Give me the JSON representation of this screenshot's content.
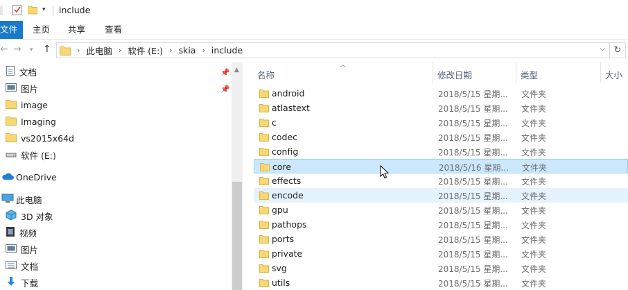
{
  "window": {
    "title": "include"
  },
  "ribbon": {
    "tabs": [
      "文件",
      "主页",
      "共享",
      "查看"
    ]
  },
  "address": {
    "crumbs": [
      "此电脑",
      "软件 (E:)",
      "skia",
      "include"
    ]
  },
  "nav": {
    "items": [
      {
        "label": "文档",
        "icon": "documents-icon",
        "pinned": true
      },
      {
        "label": "图片",
        "icon": "pictures-icon",
        "pinned": true
      },
      {
        "label": "image",
        "icon": "folder-icon"
      },
      {
        "label": "Imaging",
        "icon": "folder-icon"
      },
      {
        "label": "vs2015x64d",
        "icon": "folder-icon"
      },
      {
        "label": "软件 (E:)",
        "icon": "drive-icon"
      },
      {
        "label": "OneDrive",
        "icon": "onedrive-icon"
      },
      {
        "label": "此电脑",
        "icon": "this-pc-icon"
      },
      {
        "label": "3D 对象",
        "icon": "3d-objects-icon"
      },
      {
        "label": "视频",
        "icon": "videos-icon"
      },
      {
        "label": "图片",
        "icon": "pictures-icon"
      },
      {
        "label": "文档",
        "icon": "documents-icon"
      },
      {
        "label": "下载",
        "icon": "downloads-icon"
      }
    ]
  },
  "columns": {
    "name": "名称",
    "modified": "修改日期",
    "type": "类型",
    "size": "大小"
  },
  "files": [
    {
      "name": "android",
      "date": "2018/5/15 星期...",
      "type": "文件夹"
    },
    {
      "name": "atlastext",
      "date": "2018/5/15 星期...",
      "type": "文件夹"
    },
    {
      "name": "c",
      "date": "2018/5/15 星期...",
      "type": "文件夹"
    },
    {
      "name": "codec",
      "date": "2018/5/15 星期...",
      "type": "文件夹"
    },
    {
      "name": "config",
      "date": "2018/5/15 星期...",
      "type": "文件夹"
    },
    {
      "name": "core",
      "date": "2018/5/16 星期...",
      "type": "文件夹",
      "state": "selected"
    },
    {
      "name": "effects",
      "date": "2018/5/15 星期...",
      "type": "文件夹"
    },
    {
      "name": "encode",
      "date": "2018/5/15 星期...",
      "type": "文件夹",
      "state": "hover"
    },
    {
      "name": "gpu",
      "date": "2018/5/15 星期...",
      "type": "文件夹"
    },
    {
      "name": "pathops",
      "date": "2018/5/15 星期...",
      "type": "文件夹"
    },
    {
      "name": "ports",
      "date": "2018/5/15 星期...",
      "type": "文件夹"
    },
    {
      "name": "private",
      "date": "2018/5/15 星期...",
      "type": "文件夹"
    },
    {
      "name": "svg",
      "date": "2018/5/15 星期...",
      "type": "文件夹"
    },
    {
      "name": "utils",
      "date": "2018/5/15 星期...",
      "type": "文件夹"
    }
  ],
  "colors": {
    "accent": "#1979ca",
    "selected_bg": "#cce8ff",
    "hover_bg": "#e5f3ff",
    "folder": "#f8d775"
  }
}
